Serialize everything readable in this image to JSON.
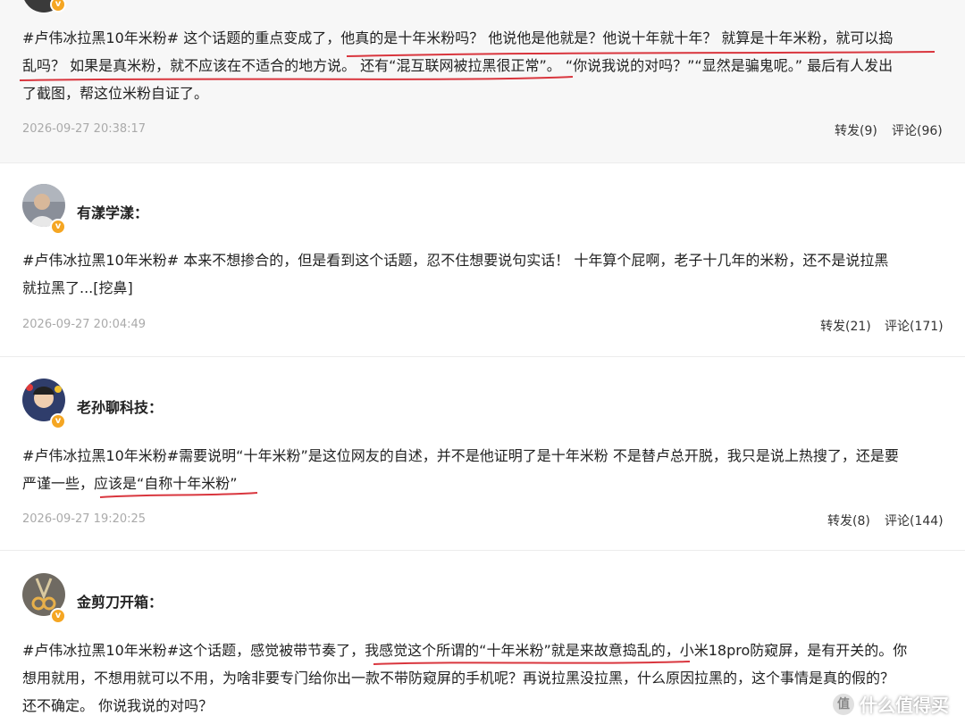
{
  "posts": [
    {
      "username": "",
      "content_line1": "#卢伟冰拉黑10年米粉# 这个话题的重点变成了，他真的是十年米粉吗？ 他说他是他就是？他说十年就十年？ 就算是十年米粉，就可以捣",
      "content_line2": "乱吗？ 如果是真米粉，就不应该在不适合的地方说。 还有“混互联网被拉黑很正常”。 “你说我说的对吗？”“显然是骗鬼呢。” 最后有人发出",
      "content_line3": "了截图，帮这位米粉自证了。",
      "time": "2026-09-27 20:38:17",
      "repost": "转发(9)",
      "comment": "评论(96)"
    },
    {
      "username": "有漾学漾：",
      "content_line1": "#卢伟冰拉黑10年米粉# 本来不想掺合的，但是看到这个话题，忍不住想要说句实话！ 十年算个屁啊，老子十几年的米粉，还不是说拉黑",
      "content_line2": "就拉黑了...[挖鼻]",
      "time": "2026-09-27 20:04:49",
      "repost": "转发(21)",
      "comment": "评论(171)"
    },
    {
      "username": "老孙聊科技：",
      "content_line1": "#卢伟冰拉黑10年米粉#需要说明“十年米粉”是这位网友的自述，并不是他证明了是十年米粉 不是替卢总开脱，我只是说上热搜了，还是要",
      "content_line2": "严谨一些，应该是“自称十年米粉”",
      "time": "2026-09-27 19:20:25",
      "repost": "转发(8)",
      "comment": "评论(144)"
    },
    {
      "username": "金剪刀开箱：",
      "content_line1": "#卢伟冰拉黑10年米粉#这个话题，感觉被带节奏了，我感觉这个所谓的“十年米粉”就是来故意捣乱的，小米18pro防窥屏，是有开关的。你",
      "content_line2": "想用就用，不想用就可以不用，为啥非要专门给你出一款不带防窥屏的手机呢？再说拉黑没拉黑，什么原因拉黑的，这个事情是真的假的？",
      "content_line3": "还不确定。 你说我说的对吗？"
    }
  ],
  "watermark": {
    "text": "什么值得买",
    "icon": "值"
  },
  "colors": {
    "underline": "#d9363e",
    "badge": "#f5a623",
    "first_post_bg": "#f7f7f7"
  }
}
